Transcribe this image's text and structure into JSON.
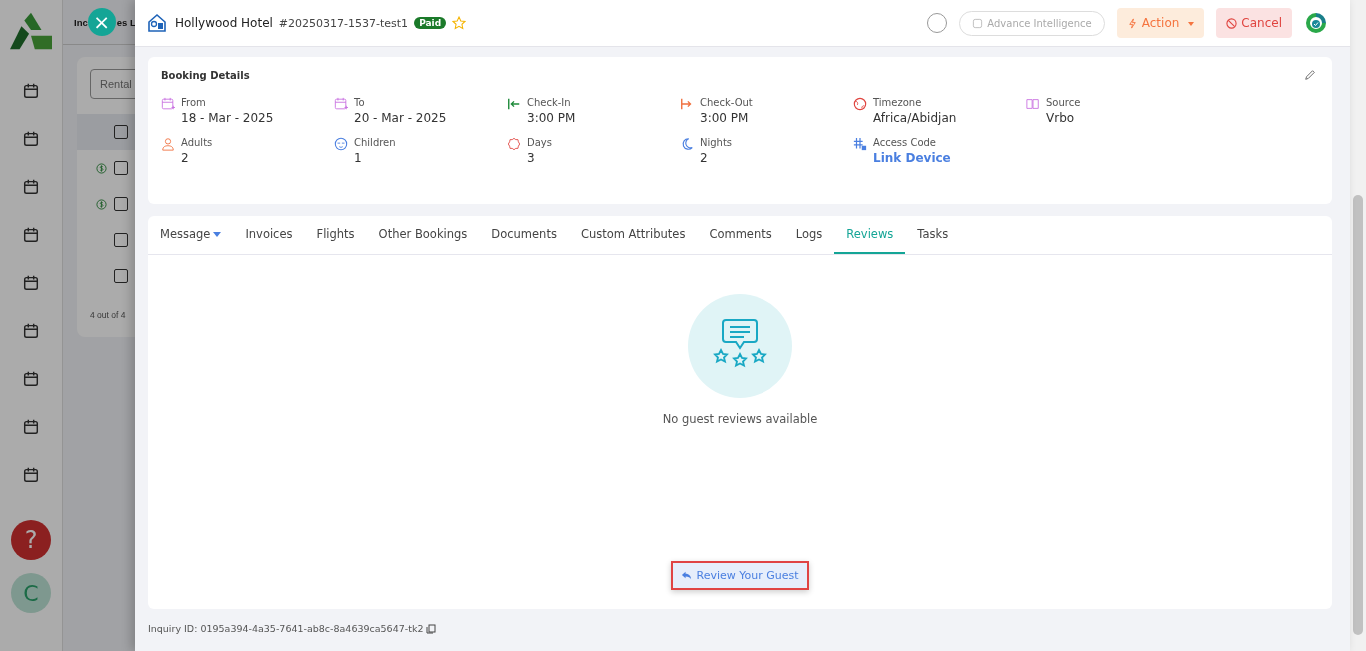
{
  "background_page": {
    "title_fragments": [
      "Inc",
      "es L"
    ],
    "filter_placeholder": "Rental",
    "rows": [
      {
        "paid": false,
        "checked": false
      },
      {
        "paid": true,
        "checked": false
      },
      {
        "paid": true,
        "checked": false
      },
      {
        "paid": false,
        "checked": false
      },
      {
        "paid": false,
        "checked": false
      }
    ],
    "footer": "4 out of 4"
  },
  "sidebar": {
    "help": "?",
    "avatar": "C"
  },
  "close_button": "×",
  "header": {
    "property": "Hollywood Hotel",
    "booking_id": "#20250317-1537-test1",
    "status": "Paid",
    "starred": false,
    "ai_button": "Advance Intelligence",
    "action_button": "Action",
    "cancel_button": "Cancel"
  },
  "booking_details": {
    "title": "Booking Details",
    "items": [
      {
        "label": "From",
        "value": "18 - Mar - 2025",
        "kind": "text"
      },
      {
        "label": "To",
        "value": "20 - Mar - 2025",
        "kind": "text"
      },
      {
        "label": "Check-In",
        "value": "3:00 PM",
        "kind": "text"
      },
      {
        "label": "Check-Out",
        "value": "3:00 PM",
        "kind": "text"
      },
      {
        "label": "Timezone",
        "value": "Africa/Abidjan",
        "kind": "text"
      },
      {
        "label": "Source",
        "value": "Vrbo",
        "kind": "text"
      },
      {
        "label": "Adults",
        "value": "2",
        "kind": "text"
      },
      {
        "label": "Children",
        "value": "1",
        "kind": "text"
      },
      {
        "label": "Days",
        "value": "3",
        "kind": "text"
      },
      {
        "label": "Nights",
        "value": "2",
        "kind": "text"
      },
      {
        "label": "Access Code",
        "value": "Link Device",
        "kind": "link"
      }
    ]
  },
  "tabs": [
    {
      "label": "Message",
      "selected": false,
      "dropdown": true
    },
    {
      "label": "Invoices",
      "selected": false
    },
    {
      "label": "Flights",
      "selected": false
    },
    {
      "label": "Other Bookings",
      "selected": false
    },
    {
      "label": "Documents",
      "selected": false
    },
    {
      "label": "Custom Attributes",
      "selected": false
    },
    {
      "label": "Comments",
      "selected": false
    },
    {
      "label": "Logs",
      "selected": false
    },
    {
      "label": "Reviews",
      "selected": true
    },
    {
      "label": "Tasks",
      "selected": false
    }
  ],
  "empty_state": {
    "message": "No guest reviews available",
    "button": "Review Your Guest"
  },
  "inquiry_id": "Inquiry ID: 0195a394-4a35-7641-ab8c-8a4639ca5647-tk2"
}
